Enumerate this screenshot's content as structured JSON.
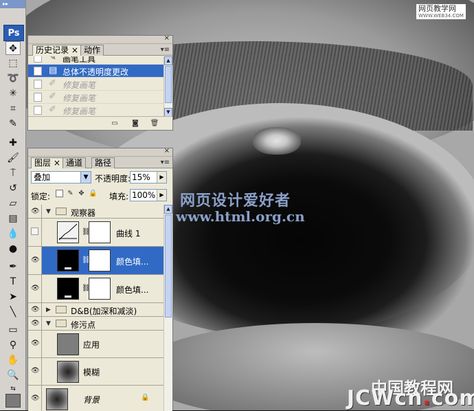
{
  "watermarks": {
    "top_right": "网页教学网",
    "top_right_sub": "WWW.WEB34.COM",
    "center_line1": "网页设计爱好者",
    "center_line2": "www.html.org.cn",
    "bottom_cn_a": "中国教程网",
    "bottom_jc_a": "JCW",
    "bottom_jc_b": "cn",
    "bottom_jc_dot": ".",
    "bottom_jc_c": "com"
  },
  "toolbar": {
    "logo": "Ps",
    "grip": "▸▸"
  },
  "history_panel": {
    "tabs": [
      "历史记录",
      "动作"
    ],
    "close": "×",
    "items": [
      {
        "label": "画笔工具",
        "icon": "brush-icon",
        "state": "normal"
      },
      {
        "label": "总体不透明度更改",
        "icon": "history-state-icon",
        "state": "selected"
      },
      {
        "label": "修复画笔",
        "icon": "bandage-icon",
        "state": "dim"
      },
      {
        "label": "修复画笔",
        "icon": "bandage-icon",
        "state": "dim"
      },
      {
        "label": "修复画笔",
        "icon": "bandage-icon",
        "state": "dim"
      }
    ]
  },
  "layers_panel": {
    "tabs": [
      "图层",
      "通道",
      "路径"
    ],
    "close": "×",
    "blend_mode": "叠加",
    "opacity_label": "不透明度:",
    "opacity_value": "15%",
    "lock_label": "锁定:",
    "fill_label": "填充:",
    "fill_value": "100%",
    "layers": [
      {
        "name": "观察器",
        "type": "group",
        "expanded": true,
        "visible": true
      },
      {
        "name": "曲线 1",
        "type": "adjustment",
        "visible": false
      },
      {
        "name": "颜色填...",
        "type": "fill",
        "visible": true,
        "selected": true
      },
      {
        "name": "颜色填...",
        "type": "fill",
        "visible": true
      },
      {
        "name": "D&B(加深和减淡)",
        "type": "group",
        "expanded": false,
        "visible": true
      },
      {
        "name": "修污点",
        "type": "group",
        "expanded": true,
        "visible": true
      },
      {
        "name": "应用",
        "type": "pixel",
        "visible": true
      },
      {
        "name": "模糊",
        "type": "pixel",
        "visible": true
      },
      {
        "name": "背景",
        "type": "background",
        "visible": true,
        "locked": true
      }
    ]
  }
}
